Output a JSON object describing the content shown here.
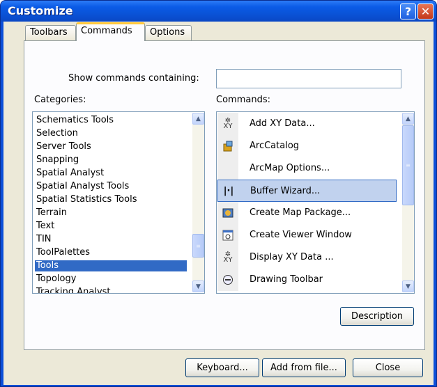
{
  "window": {
    "title": "Customize",
    "help_label": "?",
    "close_label": "✕"
  },
  "tabs": [
    {
      "label": "Toolbars"
    },
    {
      "label": "Commands"
    },
    {
      "label": "Options"
    }
  ],
  "filter": {
    "label": "Show commands containing:",
    "value": ""
  },
  "categories": {
    "label": "Categories:",
    "items": [
      "Schematics Tools",
      "Selection",
      "Server Tools",
      "Snapping",
      "Spatial Analyst",
      "Spatial Analyst Tools",
      "Spatial Statistics Tools",
      "Terrain",
      "Text",
      "TIN",
      "ToolPalettes",
      "Tools",
      "Topology",
      "Tracking Analyst"
    ],
    "selected": "Tools"
  },
  "commands": {
    "label": "Commands:",
    "items": [
      {
        "label": "Add XY Data...",
        "icon": "xy-data-icon"
      },
      {
        "label": "ArcCatalog",
        "icon": "arccatalog-icon"
      },
      {
        "label": "ArcMap Options...",
        "icon": ""
      },
      {
        "label": "Buffer Wizard...",
        "icon": "buffer-wizard-icon"
      },
      {
        "label": "Create Map Package...",
        "icon": "map-package-icon"
      },
      {
        "label": "Create Viewer Window",
        "icon": "viewer-window-icon"
      },
      {
        "label": "Display XY Data ...",
        "icon": "xy-data-icon"
      },
      {
        "label": "Drawing Toolbar",
        "icon": "drawing-toolbar-icon"
      }
    ],
    "selected": "Buffer Wizard..."
  },
  "buttons": {
    "description": "Description",
    "keyboard": "Keyboard...",
    "add_from_file": "Add from file...",
    "close": "Close"
  },
  "colors": {
    "title_bar": "#0a51d4",
    "selection": "#316ac5",
    "dialog_face": "#ece9d8"
  }
}
